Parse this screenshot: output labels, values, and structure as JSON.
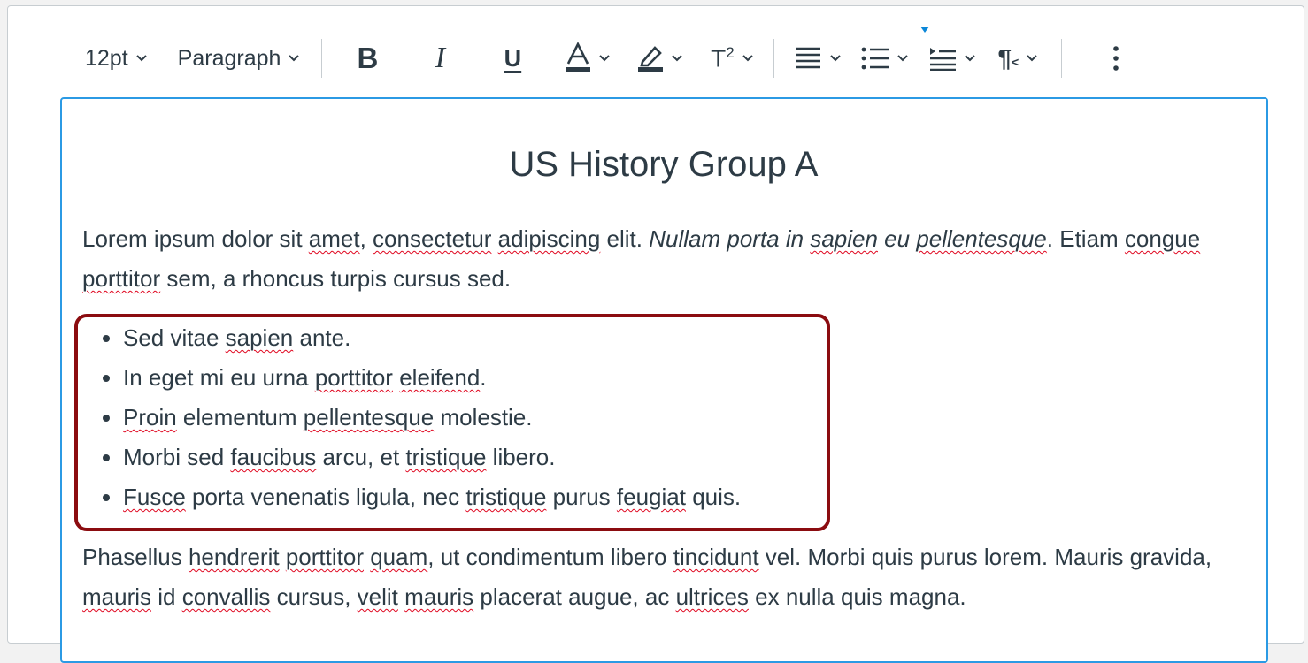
{
  "toolbar": {
    "font_size": "12pt",
    "block_format": "Paragraph",
    "bold": "B",
    "italic": "I",
    "underline": "U",
    "text_color": "A",
    "superscript_base": "T",
    "superscript_exp": "2",
    "ltr_pilcrow": "¶",
    "ltr_suffix": "<",
    "icons": [
      "chevron-down-icon",
      "bold-icon",
      "italic-icon",
      "underline-icon",
      "text-color-icon",
      "highlight-icon",
      "superscript-icon",
      "align-icon",
      "bullet-list-icon",
      "indent-icon",
      "text-direction-icon",
      "more-options-icon"
    ]
  },
  "content": {
    "heading": "US History Group A",
    "paragraph1": {
      "parts": [
        {
          "text": "Lorem ipsum dolor sit "
        },
        {
          "text": "amet",
          "spell": true
        },
        {
          "text": ", "
        },
        {
          "text": "consectetur",
          "spell": true
        },
        {
          "text": " "
        },
        {
          "text": "adipiscing",
          "spell": true
        },
        {
          "text": " elit. "
        },
        {
          "text": "Nullam porta in ",
          "italic": true
        },
        {
          "text": "sapien",
          "italic": true,
          "spell": true
        },
        {
          "text": " eu ",
          "italic": true
        },
        {
          "text": "pellentesque",
          "italic": true,
          "spell": true
        },
        {
          "text": ". Etiam "
        },
        {
          "text": "congue",
          "spell": true
        },
        {
          "text": " "
        },
        {
          "text": "porttitor",
          "spell": true
        },
        {
          "text": " sem, a rhoncus turpis cursus sed."
        }
      ]
    },
    "bullets": [
      [
        {
          "text": "Sed vitae "
        },
        {
          "text": "sapien",
          "spell": true
        },
        {
          "text": " ante."
        }
      ],
      [
        {
          "text": "In eget mi eu urna "
        },
        {
          "text": "porttitor",
          "spell": true
        },
        {
          "text": " "
        },
        {
          "text": "eleifend",
          "spell": true
        },
        {
          "text": "."
        }
      ],
      [
        {
          "text": "Proin",
          "spell": true
        },
        {
          "text": " elementum "
        },
        {
          "text": "pellentesque",
          "spell": true
        },
        {
          "text": " molestie."
        }
      ],
      [
        {
          "text": "Morbi sed "
        },
        {
          "text": "faucibus",
          "spell": true
        },
        {
          "text": " arcu, et "
        },
        {
          "text": "tristique",
          "spell": true
        },
        {
          "text": " libero."
        }
      ],
      [
        {
          "text": "Fusce",
          "spell": true
        },
        {
          "text": " porta venenatis ligula, nec "
        },
        {
          "text": "tristique",
          "spell": true
        },
        {
          "text": " purus "
        },
        {
          "text": "feugiat",
          "spell": true
        },
        {
          "text": " quis."
        }
      ]
    ],
    "paragraph2": {
      "parts": [
        {
          "text": "Phasellus "
        },
        {
          "text": "hendrerit",
          "spell": true
        },
        {
          "text": " "
        },
        {
          "text": "porttitor",
          "spell": true
        },
        {
          "text": " "
        },
        {
          "text": "quam",
          "spell": true
        },
        {
          "text": ", ut condimentum libero "
        },
        {
          "text": "tincidunt",
          "spell": true
        },
        {
          "text": " vel. Morbi quis purus lorem. Mauris gravida, "
        },
        {
          "text": "mauris",
          "spell": true
        },
        {
          "text": " id "
        },
        {
          "text": "convallis",
          "spell": true
        },
        {
          "text": " cursus, "
        },
        {
          "text": "velit",
          "spell": true
        },
        {
          "text": " "
        },
        {
          "text": "mauris",
          "spell": true
        },
        {
          "text": " placerat augue, ac "
        },
        {
          "text": "ultrices",
          "spell": true
        },
        {
          "text": " ex nulla quis magna."
        }
      ]
    }
  },
  "colors": {
    "text": "#2d3b45",
    "editor_border": "#2b9ae4",
    "callout_box": "#8b0c10",
    "spellcheck": "#e0061f",
    "active_marker": "#0b87d8"
  }
}
